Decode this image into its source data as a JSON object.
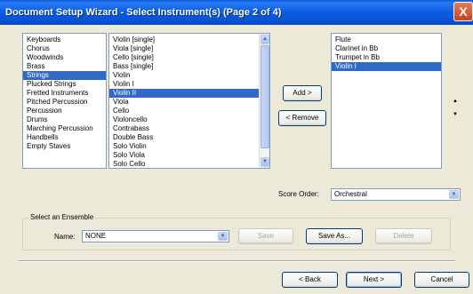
{
  "window": {
    "title": "Document Setup Wizard - Select Instrument(s) (Page 2 of 4)",
    "close_glyph": "X"
  },
  "families": {
    "items": [
      "Keyboards",
      "Chorus",
      "Woodwinds",
      "Brass",
      "Strings",
      "Plucked Strings",
      "Fretted Instruments",
      "Pitched Percussion",
      "Percussion",
      "Drums",
      "Marching Percussion",
      "Handbells",
      "Empty Staves"
    ],
    "selected": "Strings"
  },
  "instruments": {
    "items": [
      "Violin [single]",
      "Viola [single]",
      "Cello [single]",
      "Bass [single]",
      "Violin",
      "Violin I",
      "Violin II",
      "Viola",
      "Cello",
      "Violoncello",
      "Contrabass",
      "Double Bass",
      "Solo Violin",
      "Solo Viola",
      "Solo Cello"
    ],
    "selected": "Violin II",
    "scroll_up": "▲",
    "scroll_down": "▼"
  },
  "buttons": {
    "add": "Add >",
    "remove": "< Remove",
    "move_up": "▲",
    "move_down": "▼",
    "save": "Save",
    "save_as": "Save As...",
    "delete": "Delete",
    "back": "< Back",
    "next": "Next >",
    "cancel": "Cancel"
  },
  "selected_instruments": {
    "items": [
      "Flute",
      "Clarinet in Bb",
      "Trumpet in Bb",
      "Violin I"
    ],
    "selected": "Violin I"
  },
  "score_order": {
    "label": "Score Order:",
    "value": "Orchestral",
    "arrow": "▼"
  },
  "ensemble": {
    "group_label": "Select an Ensemble",
    "name_label": "Name:",
    "name_value": "NONE",
    "arrow": "▼"
  }
}
